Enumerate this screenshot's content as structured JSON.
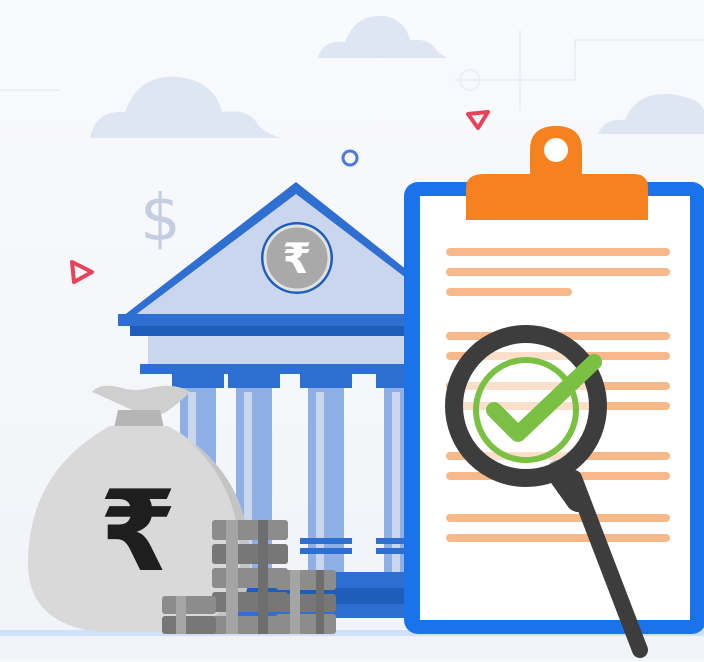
{
  "illustration": {
    "bank_coin_symbol": "₹",
    "money_bag_symbol": "₹",
    "dollar_symbol": "$"
  },
  "colors": {
    "background": "#f6f7fb",
    "cloud": "#dfe6f3",
    "bank_light": "#c9d6ee",
    "bank_mid": "#8fb0e6",
    "bank_dark": "#2f6fd1",
    "clipboard_frame": "#1a73e8",
    "clipboard_clip": "#f5821f",
    "text_lines": "#f7b98a",
    "magnifier": "#3d3d3d",
    "check": "#7ac143",
    "money_bag": "#d9d9d9",
    "coins": "#8c8c8c",
    "accent_red": "#e8425a",
    "accent_blue": "#4a7bd6"
  }
}
